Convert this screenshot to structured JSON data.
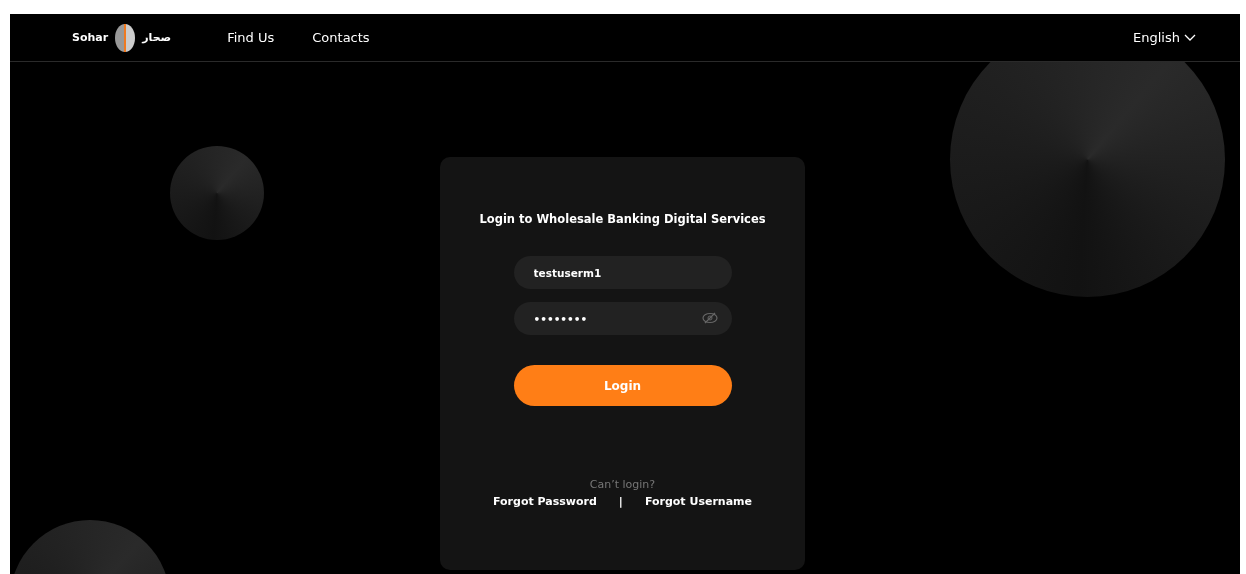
{
  "header": {
    "logo": {
      "latin": "Sohar",
      "arabic": "صحار"
    },
    "nav": [
      {
        "label": "Find Us"
      },
      {
        "label": "Contacts"
      }
    ],
    "language": "English"
  },
  "login": {
    "title": "Login to Wholesale Banking Digital Services",
    "username": {
      "value": "testuserm1"
    },
    "password": {
      "value": "••••••••"
    },
    "button": "Login",
    "help": "Can’t login?",
    "links": [
      {
        "label": "Forgot Password"
      },
      {
        "label": "Forgot Username"
      }
    ],
    "separator": "|"
  }
}
